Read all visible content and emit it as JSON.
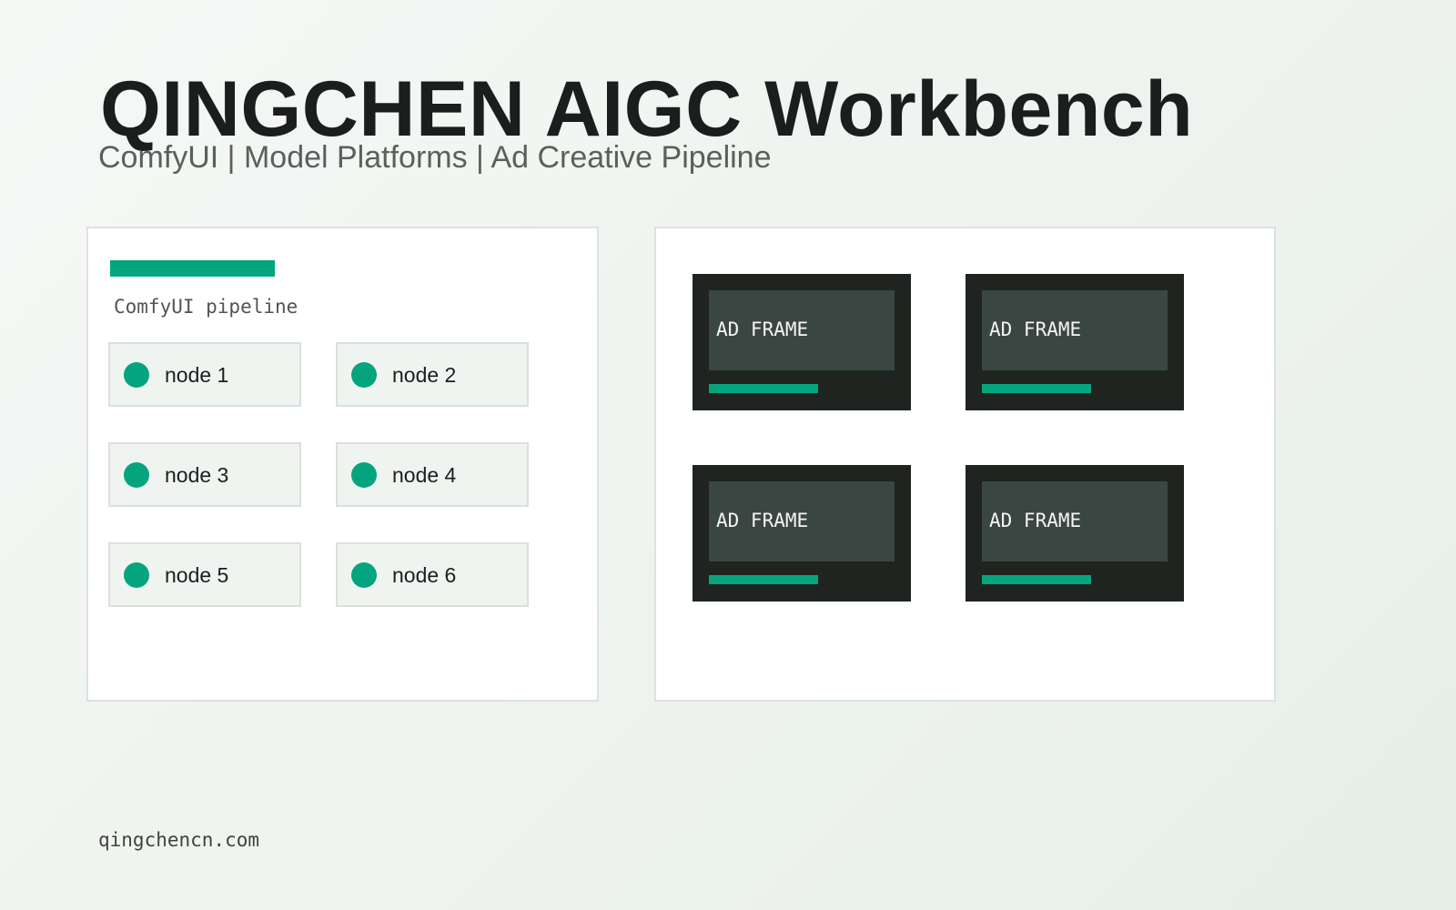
{
  "header": {
    "title": "QINGCHEN AIGC Workbench",
    "subtitle": "ComfyUI | Model Platforms | Ad Creative Pipeline"
  },
  "pipeline_panel": {
    "label": "ComfyUI pipeline",
    "nodes": [
      {
        "label": "node 1"
      },
      {
        "label": "node 2"
      },
      {
        "label": "node 3"
      },
      {
        "label": "node 4"
      },
      {
        "label": "node 5"
      },
      {
        "label": "node 6"
      }
    ]
  },
  "frames_panel": {
    "frames": [
      {
        "label": "AD FRAME"
      },
      {
        "label": "AD FRAME"
      },
      {
        "label": "AD FRAME"
      },
      {
        "label": "AD FRAME"
      }
    ]
  },
  "footer": {
    "url": "qingchencn.com"
  },
  "colors": {
    "accent": "#04a57e",
    "frame_bg": "#1f2421",
    "frame_screen": "#3a4641",
    "title": "#1b1e1c"
  }
}
